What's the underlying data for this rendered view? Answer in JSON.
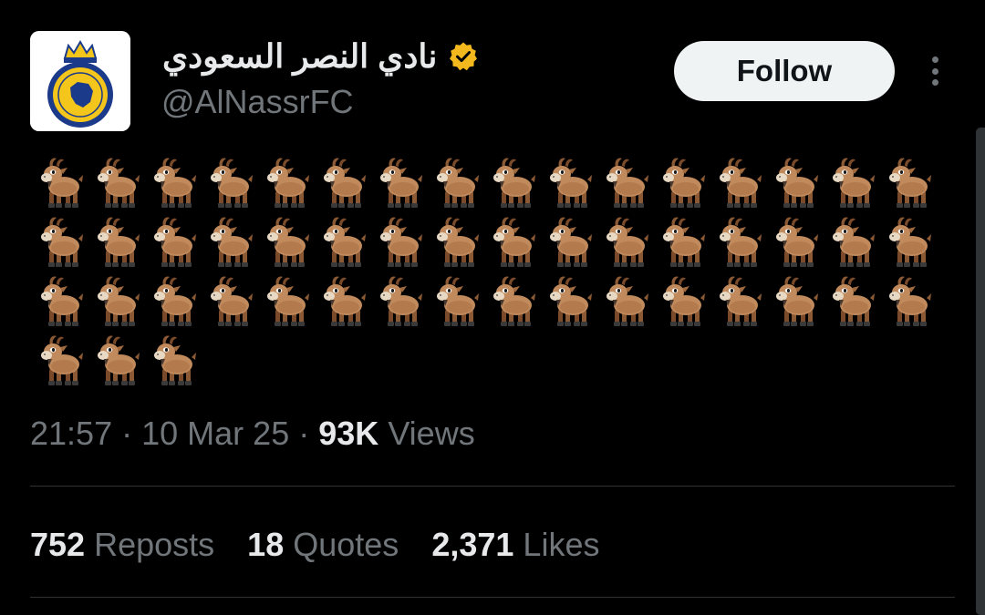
{
  "tweet": {
    "author": {
      "display_name": "نادي النصر السعودي",
      "handle": "@AlNassrFC",
      "verified_badge_color": "#f4b81f",
      "avatar_logo_text": "AL NASSR FOOTBALL CLUB"
    },
    "follow_label": "Follow",
    "more_icon": "more-vertical-icon",
    "content": {
      "emoji": "goat-emoji",
      "emoji_count": 51,
      "emoji_per_row": 16
    },
    "meta": {
      "time": "21:57",
      "date": "10 Mar 25",
      "separator": "·",
      "views_count": "93K",
      "views_label": "Views"
    },
    "stats": [
      {
        "count": "752",
        "label": "Reposts"
      },
      {
        "count": "18",
        "label": "Quotes"
      },
      {
        "count": "2,371",
        "label": "Likes"
      }
    ]
  },
  "colors": {
    "background": "#000000",
    "primary_text": "#e7e9ea",
    "secondary_text": "#71767b",
    "divider": "#2f3336",
    "follow_bg": "#eff3f4",
    "club_blue": "#1b3a8a",
    "club_yellow": "#f4c51b"
  }
}
